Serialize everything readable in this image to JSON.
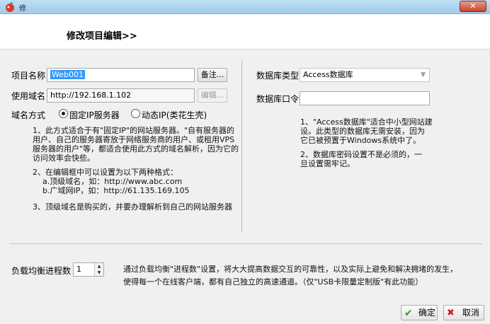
{
  "window": {
    "title": "修"
  },
  "header": {
    "title": "修改项目编辑>>"
  },
  "project": {
    "name_label": "项目名称",
    "name_value": "Web001",
    "remark_button": "备注...",
    "domain_label": "使用域名",
    "domain_value": "http://192.168.1.102",
    "edit_button": "编辑..."
  },
  "domain_mode": {
    "label": "域名方式",
    "options": [
      {
        "label": "固定IP服务器",
        "checked": true
      },
      {
        "label": "动态IP(类花生壳)",
        "checked": false
      }
    ]
  },
  "left_notes": {
    "p1": [
      "1、此方式适合于有\"固定IP\"的网站服务器。\"自有服务器的",
      "用户、自己的服务器寄放于网络服务商的用户、或租用VPS",
      "服务器的用户\"等，都适合使用此方式的域名解析，因为它的",
      "访问效率会快些。"
    ],
    "p2": [
      "2、在编辑框中可以设置为以下两种格式：",
      "a.顶级域名，如：http://www.abc.com",
      "b.广域网IP，如：http://61.135.169.105"
    ],
    "p3": [
      "3、顶级域名是购买的，并要办理解析到自己的网站服务器"
    ]
  },
  "database": {
    "type_label": "数据库类型",
    "type_value": "Access数据库",
    "password_label": "数据库口令",
    "password_value": ""
  },
  "right_notes": {
    "p1": [
      "1、\"Access数据库\"适合中小型网站建",
      "设。此类型的数据库无需安装，因为",
      "它已被预置于Windows系统中了。"
    ],
    "p2": [
      "2、数据库密码设置不是必须的，一",
      "旦设置需牢记。"
    ]
  },
  "load_balance": {
    "label": "负载均衡进程数",
    "value": "1",
    "desc": [
      "通过负载均衡\"进程数\"设置，将大大提高数据交互的可靠性，以及实际上避免和解决拥堵的发生，",
      "使得每一个在线客户端，都有自己独立的高速通道。（仅\"USB卡限量定制版\"有此功能）"
    ]
  },
  "footer": {
    "ok_label": "确定",
    "cancel_label": "取消"
  },
  "colors": {
    "selection": "#3399ff",
    "ok_icon": "#2e9a2e",
    "cancel_icon": "#d02020"
  },
  "icons": {
    "app": "app-icon",
    "close": "close-icon",
    "ok": "checkmark-icon",
    "cancel": "x-icon"
  }
}
